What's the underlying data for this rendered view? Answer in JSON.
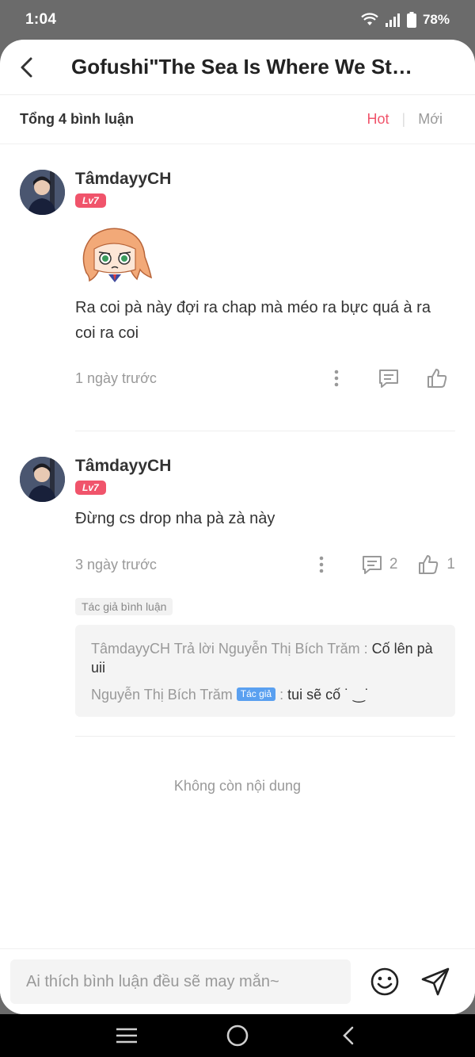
{
  "status_bar": {
    "time": "1:04",
    "battery": "78%"
  },
  "header": {
    "title": "Gofushi\"The Sea Is Where We St…"
  },
  "summary": {
    "total": "Tổng 4 bình luận",
    "tab_hot": "Hot",
    "tab_new": "Mới"
  },
  "comments": [
    {
      "user": "TâmdayyCH",
      "level": "Lv7",
      "text": "Ra coi pà này đợi ra chap mà méo ra bực quá à ra coi ra coi",
      "time": "1 ngày trước",
      "reply_count": "",
      "like_count": ""
    },
    {
      "user": "TâmdayyCH",
      "level": "Lv7",
      "text": "Đừng cs drop nha pà zà này",
      "time": "3 ngày trước",
      "reply_count": "2",
      "like_count": "1",
      "author_tag": "Tác giả bình luận",
      "replies": [
        {
          "prefix": "TâmdayyCH Trả lời Nguyễn Thị Bích Trăm : ",
          "text": "Cố lên pà uii"
        },
        {
          "prefix": "Nguyễn Thị Bích Trăm ",
          "badge": "Tác giả",
          "sep": " : ",
          "text": "tui sẽ cố ˙ ‿˙"
        }
      ]
    }
  ],
  "end_message": "Không còn nội dung",
  "input": {
    "placeholder": "Ai thích bình luận đều sẽ may mắn~"
  },
  "colors": {
    "accent": "#f0546b",
    "author_chip": "#5aa0f0"
  },
  "icons": [
    "back-icon",
    "more-icon",
    "reply-icon",
    "like-icon",
    "emoji-icon",
    "send-icon",
    "menu-icon",
    "home-icon",
    "nav-back-icon",
    "wifi-icon",
    "signal-icon",
    "battery-icon"
  ]
}
